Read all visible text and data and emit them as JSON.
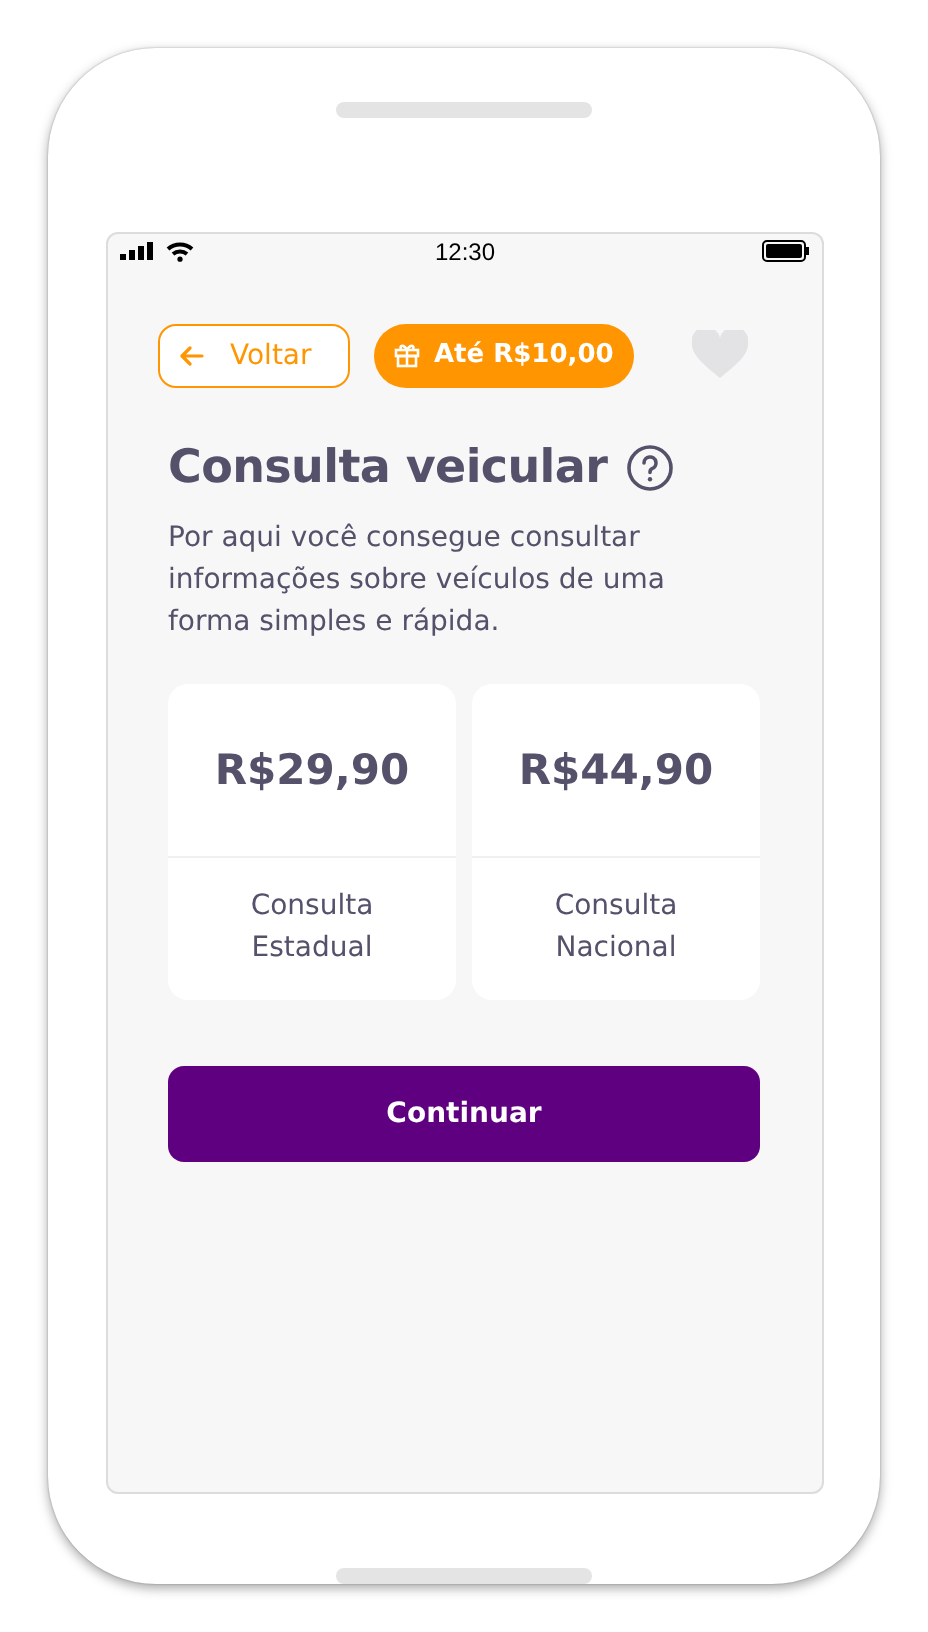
{
  "status_bar": {
    "time": "12:30"
  },
  "header": {
    "back_button": "Voltar",
    "promo_badge": "Até R$10,00",
    "favorited": false
  },
  "title": "Consulta veicular",
  "description": "Por aqui você consegue consultar informações sobre veículos de uma forma simples e rápida.",
  "options": [
    {
      "price": "R$29,90",
      "label_lines": [
        "Consulta",
        "Estadual"
      ]
    },
    {
      "price": "R$44,90",
      "label_lines": [
        "Consulta",
        "Nacional"
      ]
    }
  ],
  "primary_button": "Continuar"
}
